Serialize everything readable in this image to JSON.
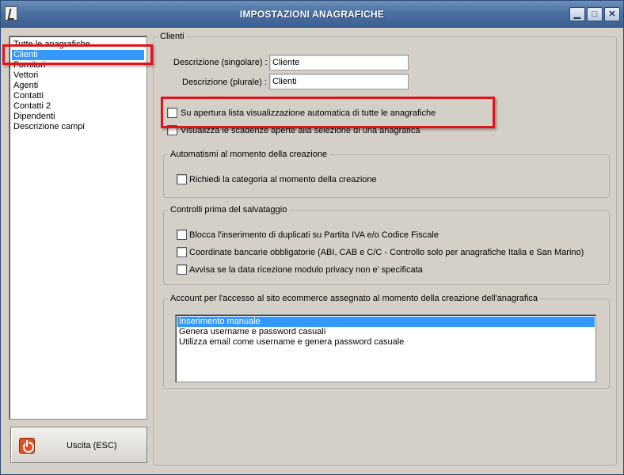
{
  "window": {
    "title": "IMPOSTAZIONI ANAGRAFICHE",
    "minimize_glyph": "▁",
    "maximize_glyph": "□",
    "close_glyph": "✕"
  },
  "sidebar": {
    "items": [
      {
        "label": "Tutte le anagrafiche",
        "selected": false
      },
      {
        "label": "Clienti",
        "selected": true
      },
      {
        "label": "Fornitori",
        "selected": false
      },
      {
        "label": "Vettori",
        "selected": false
      },
      {
        "label": "Agenti",
        "selected": false
      },
      {
        "label": "Contatti",
        "selected": false
      },
      {
        "label": "Contatti 2",
        "selected": false
      },
      {
        "label": "Dipendenti",
        "selected": false
      },
      {
        "label": "Descrizione campi",
        "selected": false
      }
    ],
    "exit_label": "Uscita (ESC)",
    "exit_icon": "power-icon"
  },
  "clienti": {
    "legend": "Clienti",
    "singular_label": "Descrizione (singolare) :",
    "singular_value": "Cliente",
    "plural_label": "Descrizione (plurale) :",
    "plural_value": "Clienti",
    "options": [
      {
        "label": "Su apertura lista visualizzazione automatica di tutte le anagrafiche",
        "checked": false
      },
      {
        "label": "Visualizza le scadenze aperte alla selezione di una anagrafica",
        "checked": false
      }
    ]
  },
  "automatismi": {
    "legend": "Automatismi al momento della creazione",
    "options": [
      {
        "label": "Richiedi la categoria al momento della creazione",
        "checked": false
      }
    ]
  },
  "controlli": {
    "legend": "Controlli prima del salvataggio",
    "options": [
      {
        "label": "Blocca l'inserimento di duplicati su Partita IVA e/o Codice Fiscale",
        "checked": false
      },
      {
        "label": "Coordinate bancarie obbligatorie (ABI, CAB e C/C - Controllo solo per anagrafiche Italia e San Marino)",
        "checked": false
      },
      {
        "label": "Avvisa se la data ricezione modulo privacy non e' specificata",
        "checked": false
      }
    ]
  },
  "account": {
    "legend": "Account per l'accesso al sito ecommerce assegnato al momento della creazione dell'anagrafica",
    "options": [
      {
        "label": "Inserimento manuale",
        "selected": true
      },
      {
        "label": "Genera username e password casuali",
        "selected": false
      },
      {
        "label": "Utilizza email come username e genera password casuale",
        "selected": false
      }
    ]
  },
  "colors": {
    "selection": "#3399ff",
    "highlight": "#e0141c",
    "window_bg": "#d4d0c8",
    "titlebar": "#4c72a3"
  }
}
